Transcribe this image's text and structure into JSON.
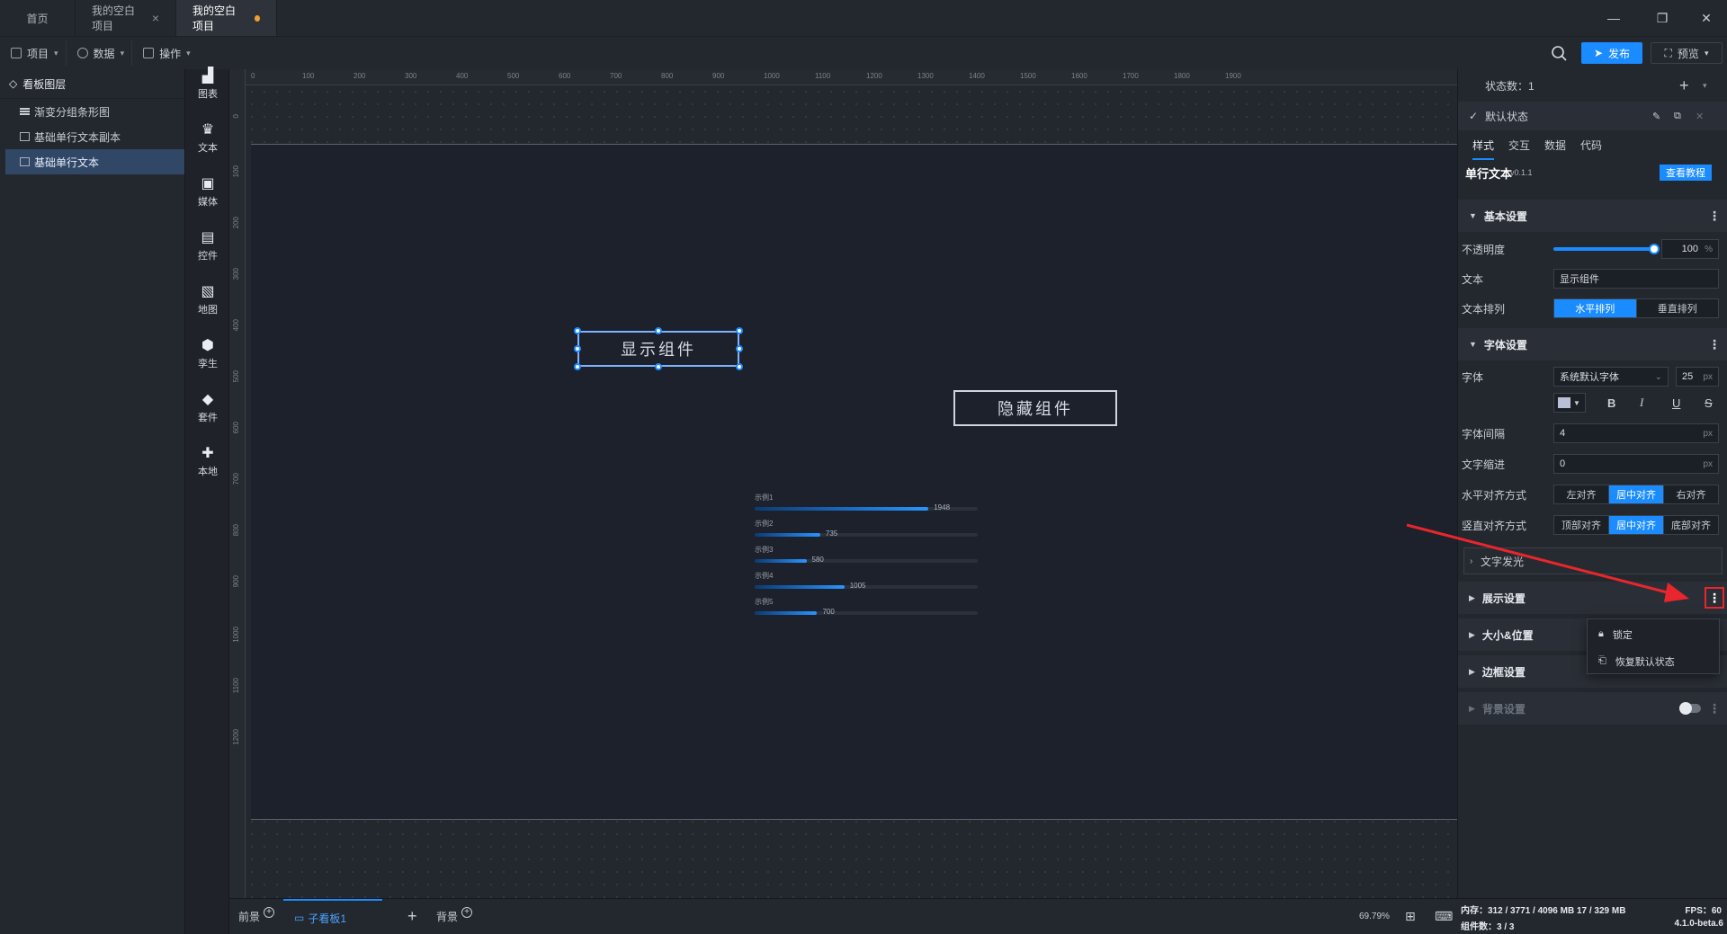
{
  "tabs": [
    {
      "label": "首页"
    },
    {
      "label": "我的空白项目"
    },
    {
      "label": "我的空白项目"
    }
  ],
  "toolbar": {
    "menus": [
      {
        "label": "项目"
      },
      {
        "label": "数据"
      },
      {
        "label": "操作"
      }
    ],
    "publish_label": "发布",
    "preview_label": "预览"
  },
  "layers": {
    "title": "看板图层",
    "items": [
      {
        "label": "渐变分组条形图",
        "icon": "bar-chart-icon"
      },
      {
        "label": "基础单行文本副本",
        "icon": "text-box-icon"
      },
      {
        "label": "基础单行文本",
        "icon": "text-box-icon"
      }
    ]
  },
  "components": [
    {
      "label": "图表",
      "icon": "chart-icon"
    },
    {
      "label": "文本",
      "icon": "text-icon"
    },
    {
      "label": "媒体",
      "icon": "media-icon"
    },
    {
      "label": "控件",
      "icon": "control-icon"
    },
    {
      "label": "地图",
      "icon": "map-icon"
    },
    {
      "label": "孪生",
      "icon": "twin-icon"
    },
    {
      "label": "套件",
      "icon": "kit-icon"
    },
    {
      "label": "本地",
      "icon": "local-icon"
    }
  ],
  "ruler": {
    "top": [
      "0",
      "100",
      "200",
      "300",
      "400",
      "500",
      "600",
      "700",
      "800",
      "900",
      "1000",
      "1100",
      "1200",
      "1300",
      "1400",
      "1500",
      "1600",
      "1700",
      "1800",
      "1900"
    ],
    "left": [
      "0",
      "100",
      "200",
      "300",
      "400",
      "500",
      "600",
      "700",
      "800",
      "900",
      "1000",
      "1100",
      "1200"
    ]
  },
  "canvas": {
    "show_button": "显示组件",
    "hide_button": "隐藏组件"
  },
  "chart_data": {
    "type": "bar",
    "orientation": "horizontal",
    "categories": [
      "示例1",
      "示例2",
      "示例3",
      "示例4",
      "示例5"
    ],
    "values": [
      1948,
      735,
      580,
      1005,
      700
    ],
    "xlim": [
      0,
      2500
    ]
  },
  "bottom": {
    "front_label": "前景",
    "board_label": "子看板1",
    "background_label": "背景",
    "zoom": "69.79%"
  },
  "right_panel": {
    "state_count_label": "状态数：1",
    "default_state": "默认状态",
    "tabs": [
      "样式",
      "交互",
      "数据",
      "代码"
    ],
    "component_name": "单行文本",
    "version": "v0.1.1",
    "tutorial_button": "查看教程",
    "basic_section": "基本设置",
    "opacity_label": "不透明度",
    "opacity_value": "100",
    "opacity_unit": "%",
    "opacity_level": 1.0,
    "text_label": "文本",
    "text_value": "显示组件",
    "arrange_label": "文本排列",
    "arrange_options": [
      "水平排列",
      "垂直排列"
    ],
    "font_section": "字体设置",
    "font_label": "字体",
    "font_value": "系统默认字体",
    "font_size": "25",
    "font_size_unit": "px",
    "spacing_label": "字体间隔",
    "spacing_value": "4",
    "indent_label": "文字缩进",
    "indent_value": "0",
    "px": "px",
    "halign_label": "水平对齐方式",
    "halign_options": [
      "左对齐",
      "居中对齐",
      "右对齐"
    ],
    "valign_label": "竖直对齐方式",
    "valign_options": [
      "顶部对齐",
      "居中对齐",
      "底部对齐"
    ],
    "glow_label": "文字发光",
    "display_section": "展示设置",
    "size_section": "大小&位置",
    "border_section": "边框设置",
    "bg_section": "背景设置"
  },
  "dropdown": {
    "lock": "锁定",
    "restore": "恢复默认状态"
  },
  "status": {
    "memory": "内存：312 / 3771 / 4096 MB  17 / 329 MB",
    "fps": "FPS：60",
    "count": "组件数：3 / 3",
    "version": "4.1.0-beta.6"
  },
  "colors": {
    "accent": "#1a8cff",
    "alert": "#e8262b",
    "modified_dot": "#f0a030"
  }
}
